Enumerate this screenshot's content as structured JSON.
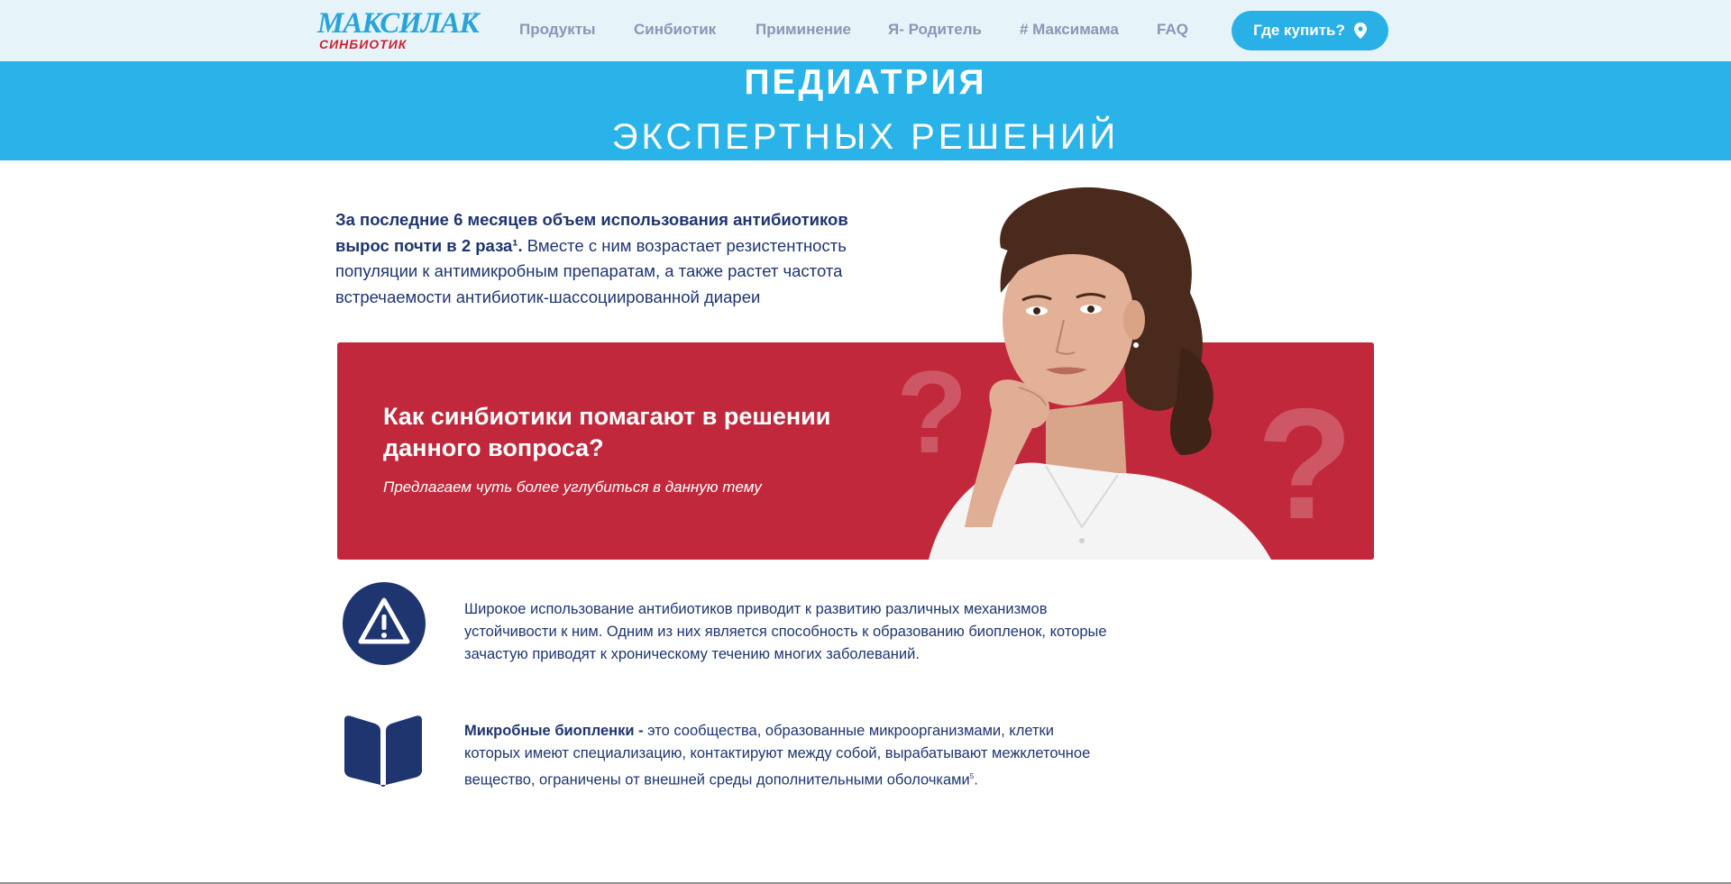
{
  "header": {
    "logo": {
      "main": "МАКСИЛАК",
      "reg": "®",
      "sub": "СИНБИОТИК"
    },
    "nav": [
      {
        "label": "Продукты"
      },
      {
        "label": "Синбиотик"
      },
      {
        "label": "Приминение"
      },
      {
        "label": "Я- Родитель"
      },
      {
        "label": "# Максимама"
      },
      {
        "label": "FAQ"
      }
    ],
    "buy_button": {
      "label": "Где купить?",
      "icon": "map-pin-icon"
    }
  },
  "banner": {
    "title": "ПЕДИАТРИЯ",
    "subtitle": "ЭКСПЕРТНЫХ РЕШЕНИЙ"
  },
  "intro": {
    "bold_part_1": "За последние ",
    "bold_num_1": "6",
    "bold_part_2": " месяцев объем использования антибиотиков вырос почти в ",
    "bold_num_2": "2",
    "bold_part_3": " раза¹.",
    "regular": " Вместе с ним возрастает резистентность популяции к антимикробным препаратам, а также растет частота встречаемости антибиотик-шассоциированной диареи"
  },
  "card": {
    "title": "Как синбиотики помагают в решении данного вопроса?",
    "subtitle": "Предлагаем чуть более углубиться в данную тему",
    "decor": "?"
  },
  "info": [
    {
      "icon": "warning-icon",
      "text": "Широкое использование антибиотиков приводит к развитию различных механизмов устойчивости к ним. Одним из них является способность к образованию биопленок, которые зачастую приводят к хроническому течению многих заболеваний."
    },
    {
      "icon": "book-icon",
      "bold": "Микробные биопленки - ",
      "text": " это сообщества, образованные микроорганизмами, клетки которых имеют специализацию, контактируют между собой, вырабатывают межклеточное вещество, ограничены от внешней среды дополнительными оболочками",
      "sup": "5",
      "end": "."
    }
  ],
  "colors": {
    "brand_blue": "#29b3e8",
    "navy": "#1e3570",
    "red": "#c1283c",
    "header_bg": "#e6f4fa",
    "nav_text": "#8a96b4"
  }
}
